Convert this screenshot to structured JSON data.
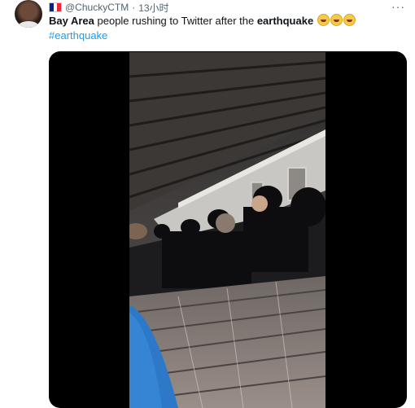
{
  "author": {
    "handle": "@ChuckyCTM",
    "separator": "·",
    "time": "13小时",
    "flag": "france-flag"
  },
  "more_label": "···",
  "tweet": {
    "part1_bold": "Bay Area",
    "part2": " people rushing to Twitter after the ",
    "part3_bold": "earthquake",
    "emojis": [
      "rolling-on-floor-laughing-emoji",
      "rolling-on-floor-laughing-emoji",
      "rolling-on-floor-laughing-emoji"
    ],
    "hashtag": "#earthquake"
  },
  "media": {
    "type": "video",
    "content": "crowded escalator video"
  },
  "colors": {
    "link": "#1d9bf0",
    "text": "#0f1419",
    "secondary": "#536471",
    "media_bg": "#000000"
  }
}
